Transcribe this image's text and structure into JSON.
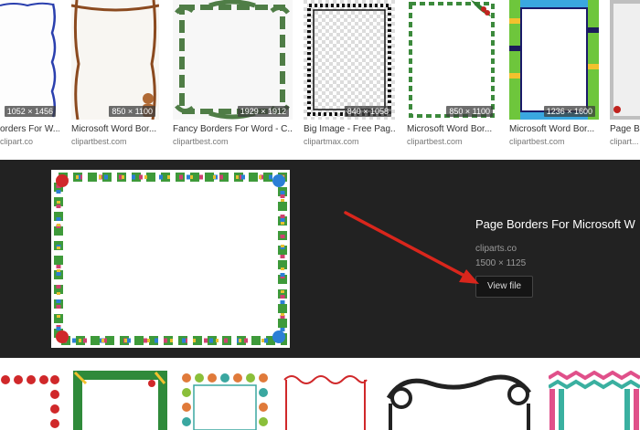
{
  "top_row": [
    {
      "title": "orders For W...",
      "source": "clipart.co",
      "dims": "1052 × 1456"
    },
    {
      "title": "Microsoft Word Bor...",
      "source": "clipartbest.com",
      "dims": "850 × 1100"
    },
    {
      "title": "Fancy Borders For Word - C...",
      "source": "clipartbest.com",
      "dims": "1929 × 1912"
    },
    {
      "title": "Big Image - Free Pag...",
      "source": "clipartmax.com",
      "dims": "840 × 1058"
    },
    {
      "title": "Microsoft Word Bor...",
      "source": "clipartbest.com",
      "dims": "850 × 1100"
    },
    {
      "title": "Microsoft Word Bor...",
      "source": "clipartbest.com",
      "dims": "1236 × 1600"
    },
    {
      "title": "Page B...",
      "source": "clipart...",
      "dims": ""
    }
  ],
  "preview": {
    "title": "Page Borders For Microsoft W",
    "source": "cliparts.co",
    "dims": "1500 × 1125",
    "button_label": "View file"
  },
  "colors": {
    "panel_bg": "#222222",
    "arrow": "#d9261c"
  }
}
